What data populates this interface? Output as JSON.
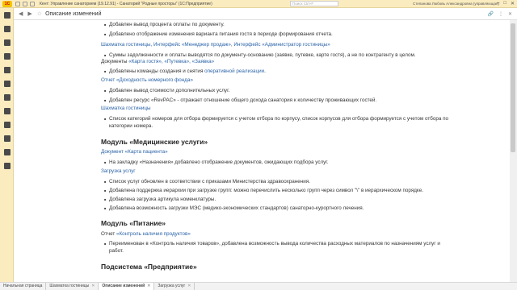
{
  "window": {
    "title": "Кент: Управление санаторием (19.12.91) - Санаторий \"Родные просторы\" (1С:Предприятие)",
    "search_placeholder": "Поиск Ctrl+F",
    "user": "Степанова Любовь Александровна (управляющая)"
  },
  "header": {
    "title": "Описание изменений"
  },
  "content": {
    "r1": "Добавлен вывод процента оплаты по документу.",
    "r2": "Добавлено отображение изменения варианта питания гостя в периоде формирования отчета.",
    "r3a": "Шахматка гостиницы, Интерфейс «Менеджер продаж», Интерфейс «Администратор гостиницы»",
    "r4": "Суммы задолженности и оплаты выводятся по документу-основанию (заявке, путевке, карте гостя), а не по контрагенту в целом.",
    "r5pre": "Документы ",
    "r5l": "«Карта гостя», «Путевка», «Заявка»",
    "r6pre": "Добавлены команды создания и снятия ",
    "r6l": "оперативной реализации",
    "r6post": ".",
    "r7": "Отчет «Доходность номерного фонда»",
    "r8": "Добавлен вывод стоимости дополнительных услуг.",
    "r9": "Добавлен ресурс «RevPAC» - отражает отношение общего дохода санатория к количеству проживающих гостей.",
    "r10": "Шахматка гостиницы",
    "r11": "Список категорий номеров для отбора формируется с учетом отбора по корпусу, список корпусов для отбора формируется с учетом отбора по",
    "r11b": "категории номера.",
    "h1": "Модуль «Медицинские услуги»",
    "r12": "Документ «Карта пациента»",
    "r13": "На закладку «Назначения» добавлено отображение документов, ожидающих подбора услуг.",
    "r14": "Загрузка услуг",
    "r15": "Список услуг обновлен в соответствии с приказами Министерства здравоохранения.",
    "r16": "Добавлена поддержка иерархии при загрузке групп: можно перечислить несколько групп через символ \"\\\" в иерархическом порядке.",
    "r17": "Добавлена загрузка артикула номенклатуры.",
    "r18": "Добавлена возможность загрузки МЭС (медико-экономических стандартов) санаторно-курортного лечения.",
    "h2": "Модуль «Питание»",
    "r19pre": "Отчет ",
    "r19l": "«Контроль наличия продуктов»",
    "r20": "Переименован в «Контроль наличия товаров», добавлена возможность вывода количества расходных материалов по назначениям услуг и",
    "r20b": "работ.",
    "h3": "Подсистема «Предприятие»"
  },
  "tabs": [
    {
      "label": "Начальная страница"
    },
    {
      "label": "Шахматка гостиницы"
    },
    {
      "label": "Описание изменений"
    },
    {
      "label": "Загрузка услуг"
    }
  ]
}
